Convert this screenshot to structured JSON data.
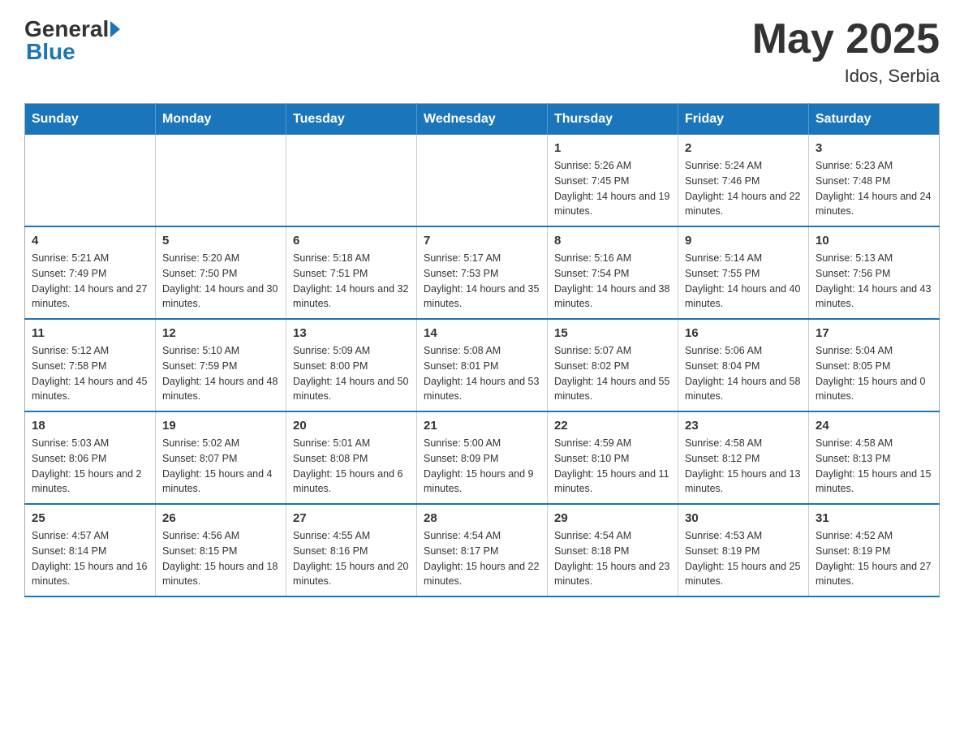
{
  "header": {
    "logo": {
      "general": "General",
      "blue": "Blue"
    },
    "title": "May 2025",
    "location": "Idos, Serbia"
  },
  "weekdays": [
    "Sunday",
    "Monday",
    "Tuesday",
    "Wednesday",
    "Thursday",
    "Friday",
    "Saturday"
  ],
  "weeks": [
    [
      {
        "day": "",
        "info": ""
      },
      {
        "day": "",
        "info": ""
      },
      {
        "day": "",
        "info": ""
      },
      {
        "day": "",
        "info": ""
      },
      {
        "day": "1",
        "info": "Sunrise: 5:26 AM\nSunset: 7:45 PM\nDaylight: 14 hours and 19 minutes."
      },
      {
        "day": "2",
        "info": "Sunrise: 5:24 AM\nSunset: 7:46 PM\nDaylight: 14 hours and 22 minutes."
      },
      {
        "day": "3",
        "info": "Sunrise: 5:23 AM\nSunset: 7:48 PM\nDaylight: 14 hours and 24 minutes."
      }
    ],
    [
      {
        "day": "4",
        "info": "Sunrise: 5:21 AM\nSunset: 7:49 PM\nDaylight: 14 hours and 27 minutes."
      },
      {
        "day": "5",
        "info": "Sunrise: 5:20 AM\nSunset: 7:50 PM\nDaylight: 14 hours and 30 minutes."
      },
      {
        "day": "6",
        "info": "Sunrise: 5:18 AM\nSunset: 7:51 PM\nDaylight: 14 hours and 32 minutes."
      },
      {
        "day": "7",
        "info": "Sunrise: 5:17 AM\nSunset: 7:53 PM\nDaylight: 14 hours and 35 minutes."
      },
      {
        "day": "8",
        "info": "Sunrise: 5:16 AM\nSunset: 7:54 PM\nDaylight: 14 hours and 38 minutes."
      },
      {
        "day": "9",
        "info": "Sunrise: 5:14 AM\nSunset: 7:55 PM\nDaylight: 14 hours and 40 minutes."
      },
      {
        "day": "10",
        "info": "Sunrise: 5:13 AM\nSunset: 7:56 PM\nDaylight: 14 hours and 43 minutes."
      }
    ],
    [
      {
        "day": "11",
        "info": "Sunrise: 5:12 AM\nSunset: 7:58 PM\nDaylight: 14 hours and 45 minutes."
      },
      {
        "day": "12",
        "info": "Sunrise: 5:10 AM\nSunset: 7:59 PM\nDaylight: 14 hours and 48 minutes."
      },
      {
        "day": "13",
        "info": "Sunrise: 5:09 AM\nSunset: 8:00 PM\nDaylight: 14 hours and 50 minutes."
      },
      {
        "day": "14",
        "info": "Sunrise: 5:08 AM\nSunset: 8:01 PM\nDaylight: 14 hours and 53 minutes."
      },
      {
        "day": "15",
        "info": "Sunrise: 5:07 AM\nSunset: 8:02 PM\nDaylight: 14 hours and 55 minutes."
      },
      {
        "day": "16",
        "info": "Sunrise: 5:06 AM\nSunset: 8:04 PM\nDaylight: 14 hours and 58 minutes."
      },
      {
        "day": "17",
        "info": "Sunrise: 5:04 AM\nSunset: 8:05 PM\nDaylight: 15 hours and 0 minutes."
      }
    ],
    [
      {
        "day": "18",
        "info": "Sunrise: 5:03 AM\nSunset: 8:06 PM\nDaylight: 15 hours and 2 minutes."
      },
      {
        "day": "19",
        "info": "Sunrise: 5:02 AM\nSunset: 8:07 PM\nDaylight: 15 hours and 4 minutes."
      },
      {
        "day": "20",
        "info": "Sunrise: 5:01 AM\nSunset: 8:08 PM\nDaylight: 15 hours and 6 minutes."
      },
      {
        "day": "21",
        "info": "Sunrise: 5:00 AM\nSunset: 8:09 PM\nDaylight: 15 hours and 9 minutes."
      },
      {
        "day": "22",
        "info": "Sunrise: 4:59 AM\nSunset: 8:10 PM\nDaylight: 15 hours and 11 minutes."
      },
      {
        "day": "23",
        "info": "Sunrise: 4:58 AM\nSunset: 8:12 PM\nDaylight: 15 hours and 13 minutes."
      },
      {
        "day": "24",
        "info": "Sunrise: 4:58 AM\nSunset: 8:13 PM\nDaylight: 15 hours and 15 minutes."
      }
    ],
    [
      {
        "day": "25",
        "info": "Sunrise: 4:57 AM\nSunset: 8:14 PM\nDaylight: 15 hours and 16 minutes."
      },
      {
        "day": "26",
        "info": "Sunrise: 4:56 AM\nSunset: 8:15 PM\nDaylight: 15 hours and 18 minutes."
      },
      {
        "day": "27",
        "info": "Sunrise: 4:55 AM\nSunset: 8:16 PM\nDaylight: 15 hours and 20 minutes."
      },
      {
        "day": "28",
        "info": "Sunrise: 4:54 AM\nSunset: 8:17 PM\nDaylight: 15 hours and 22 minutes."
      },
      {
        "day": "29",
        "info": "Sunrise: 4:54 AM\nSunset: 8:18 PM\nDaylight: 15 hours and 23 minutes."
      },
      {
        "day": "30",
        "info": "Sunrise: 4:53 AM\nSunset: 8:19 PM\nDaylight: 15 hours and 25 minutes."
      },
      {
        "day": "31",
        "info": "Sunrise: 4:52 AM\nSunset: 8:19 PM\nDaylight: 15 hours and 27 minutes."
      }
    ]
  ]
}
